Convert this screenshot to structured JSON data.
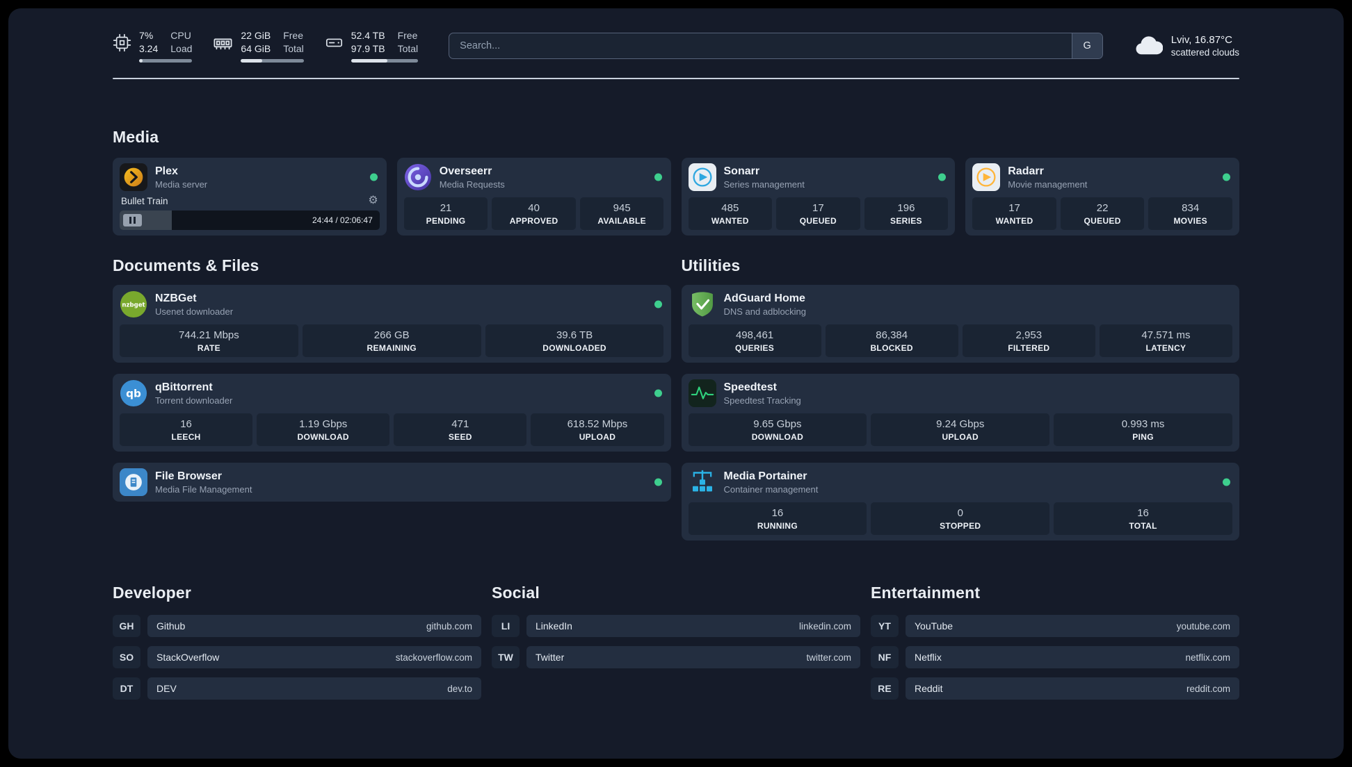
{
  "colors": {
    "background": "#151b29",
    "card": "#232e40",
    "stat_box": "#1a2433",
    "status_online": "#3ecf8e",
    "accent_plex": "#e5a00d",
    "accent_overseerr": "#6d5ce0",
    "accent_sonarr": "#2ea7e0",
    "accent_radarr": "#ffb53a",
    "accent_adguard": "#5fae52",
    "accent_speedtest": "#2fd27d",
    "accent_portainer": "#2bb3e6"
  },
  "topbar": {
    "cpu": {
      "icon": "cpu-chip-icon",
      "value_top": "7%",
      "label_top": "CPU",
      "value_bottom": "3.24",
      "label_bottom": "Load",
      "bar_percent": 7
    },
    "memory": {
      "icon": "memory-icon",
      "value_top": "22 GiB",
      "label_top": "Free",
      "value_bottom": "64 GiB",
      "label_bottom": "Total",
      "bar_percent": 34
    },
    "disk": {
      "icon": "hard-drive-icon",
      "value_top": "52.4 TB",
      "label_top": "Free",
      "value_bottom": "97.9 TB",
      "label_bottom": "Total",
      "bar_percent": 54
    },
    "search": {
      "placeholder": "Search...",
      "engine_button": "G"
    },
    "weather": {
      "icon": "cloud-icon",
      "location": "Lviv, 16.87°C",
      "condition": "scattered clouds"
    }
  },
  "media": {
    "title": "Media",
    "plex": {
      "name": "Plex",
      "desc": "Media server",
      "online": true,
      "now_playing": "Bullet Train",
      "time": "24:44 / 02:06:47",
      "progress_percent": 20
    },
    "overseerr": {
      "name": "Overseerr",
      "desc": "Media Requests",
      "online": true,
      "stats": [
        {
          "value": "21",
          "label": "PENDING"
        },
        {
          "value": "40",
          "label": "APPROVED"
        },
        {
          "value": "945",
          "label": "AVAILABLE"
        }
      ]
    },
    "sonarr": {
      "name": "Sonarr",
      "desc": "Series management",
      "online": true,
      "stats": [
        {
          "value": "485",
          "label": "WANTED"
        },
        {
          "value": "17",
          "label": "QUEUED"
        },
        {
          "value": "196",
          "label": "SERIES"
        }
      ]
    },
    "radarr": {
      "name": "Radarr",
      "desc": "Movie management",
      "online": true,
      "stats": [
        {
          "value": "17",
          "label": "WANTED"
        },
        {
          "value": "22",
          "label": "QUEUED"
        },
        {
          "value": "834",
          "label": "MOVIES"
        }
      ]
    }
  },
  "documents": {
    "title": "Documents & Files",
    "nzbget": {
      "name": "NZBGet",
      "desc": "Usenet downloader",
      "online": true,
      "stats": [
        {
          "value": "744.21 Mbps",
          "label": "RATE"
        },
        {
          "value": "266 GB",
          "label": "REMAINING"
        },
        {
          "value": "39.6 TB",
          "label": "DOWNLOADED"
        }
      ]
    },
    "qbittorrent": {
      "name": "qBittorrent",
      "desc": "Torrent downloader",
      "online": true,
      "stats": [
        {
          "value": "16",
          "label": "LEECH"
        },
        {
          "value": "1.19 Gbps",
          "label": "DOWNLOAD"
        },
        {
          "value": "471",
          "label": "SEED"
        },
        {
          "value": "618.52 Mbps",
          "label": "UPLOAD"
        }
      ]
    },
    "filebrowser": {
      "name": "File Browser",
      "desc": "Media File Management",
      "online": true
    }
  },
  "utilities": {
    "title": "Utilities",
    "adguard": {
      "name": "AdGuard Home",
      "desc": "DNS and adblocking",
      "stats": [
        {
          "value": "498,461",
          "label": "QUERIES"
        },
        {
          "value": "86,384",
          "label": "BLOCKED"
        },
        {
          "value": "2,953",
          "label": "FILTERED"
        },
        {
          "value": "47.571 ms",
          "label": "LATENCY"
        }
      ]
    },
    "speedtest": {
      "name": "Speedtest",
      "desc": "Speedtest Tracking",
      "stats": [
        {
          "value": "9.65 Gbps",
          "label": "DOWNLOAD"
        },
        {
          "value": "9.24 Gbps",
          "label": "UPLOAD"
        },
        {
          "value": "0.993 ms",
          "label": "PING"
        }
      ]
    },
    "portainer": {
      "name": "Media Portainer",
      "desc": "Container management",
      "online": true,
      "stats": [
        {
          "value": "16",
          "label": "RUNNING"
        },
        {
          "value": "0",
          "label": "STOPPED"
        },
        {
          "value": "16",
          "label": "TOTAL"
        }
      ]
    }
  },
  "bookmarks": {
    "developer": {
      "title": "Developer",
      "items": [
        {
          "abbr": "GH",
          "name": "Github",
          "url": "github.com"
        },
        {
          "abbr": "SO",
          "name": "StackOverflow",
          "url": "stackoverflow.com"
        },
        {
          "abbr": "DT",
          "name": "DEV",
          "url": "dev.to"
        }
      ]
    },
    "social": {
      "title": "Social",
      "items": [
        {
          "abbr": "LI",
          "name": "LinkedIn",
          "url": "linkedin.com"
        },
        {
          "abbr": "TW",
          "name": "Twitter",
          "url": "twitter.com"
        }
      ]
    },
    "entertainment": {
      "title": "Entertainment",
      "items": [
        {
          "abbr": "YT",
          "name": "YouTube",
          "url": "youtube.com"
        },
        {
          "abbr": "NF",
          "name": "Netflix",
          "url": "netflix.com"
        },
        {
          "abbr": "RE",
          "name": "Reddit",
          "url": "reddit.com"
        }
      ]
    }
  }
}
